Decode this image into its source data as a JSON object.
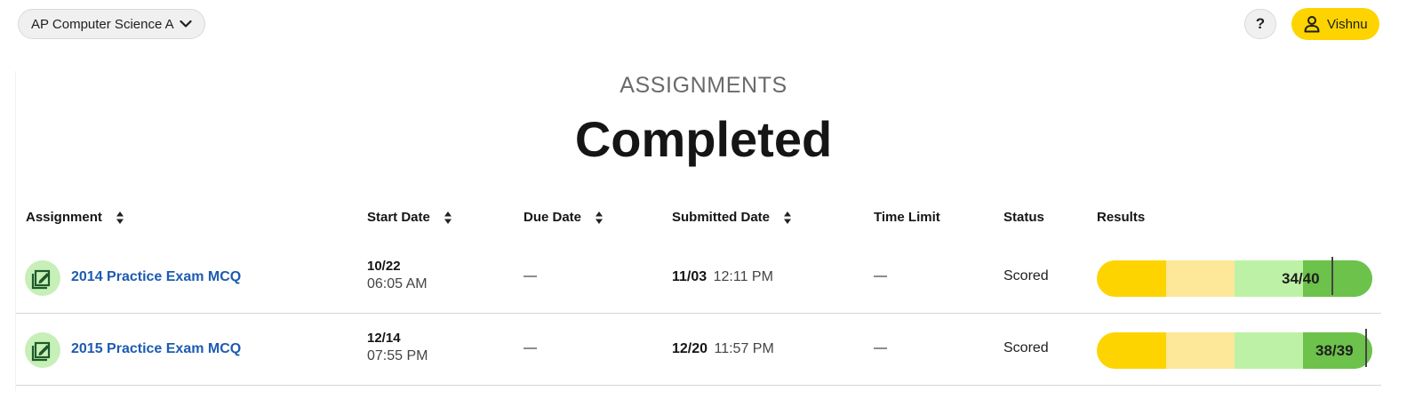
{
  "header": {
    "course": "AP Computer Science A",
    "help_label": "?",
    "user_name": "Vishnu"
  },
  "page": {
    "eyebrow": "ASSIGNMENTS",
    "title": "Completed"
  },
  "table": {
    "columns": [
      "Assignment",
      "Start Date",
      "Due Date",
      "Submitted Date",
      "Time Limit",
      "Status",
      "Results"
    ],
    "rows": [
      {
        "name": "2014 Practice Exam MCQ",
        "start_date": "10/22",
        "start_time": "06:05 AM",
        "due_date": "—",
        "submitted_date": "11/03",
        "submitted_time": "12:11 PM",
        "time_limit": "—",
        "status": "Scored",
        "score": "34/40",
        "score_fraction": 0.85
      },
      {
        "name": "2015 Practice Exam MCQ",
        "start_date": "12/14",
        "start_time": "07:55 PM",
        "due_date": "—",
        "submitted_date": "12/20",
        "submitted_time": "11:57 PM",
        "time_limit": "—",
        "status": "Scored",
        "score": "38/39",
        "score_fraction": 0.974
      }
    ]
  },
  "colors": {
    "accent_yellow": "#fdd400",
    "band_light_yellow": "#fde89a",
    "band_light_green": "#bdf2a6",
    "band_green": "#6cc24a",
    "link_blue": "#1d5bb0"
  }
}
